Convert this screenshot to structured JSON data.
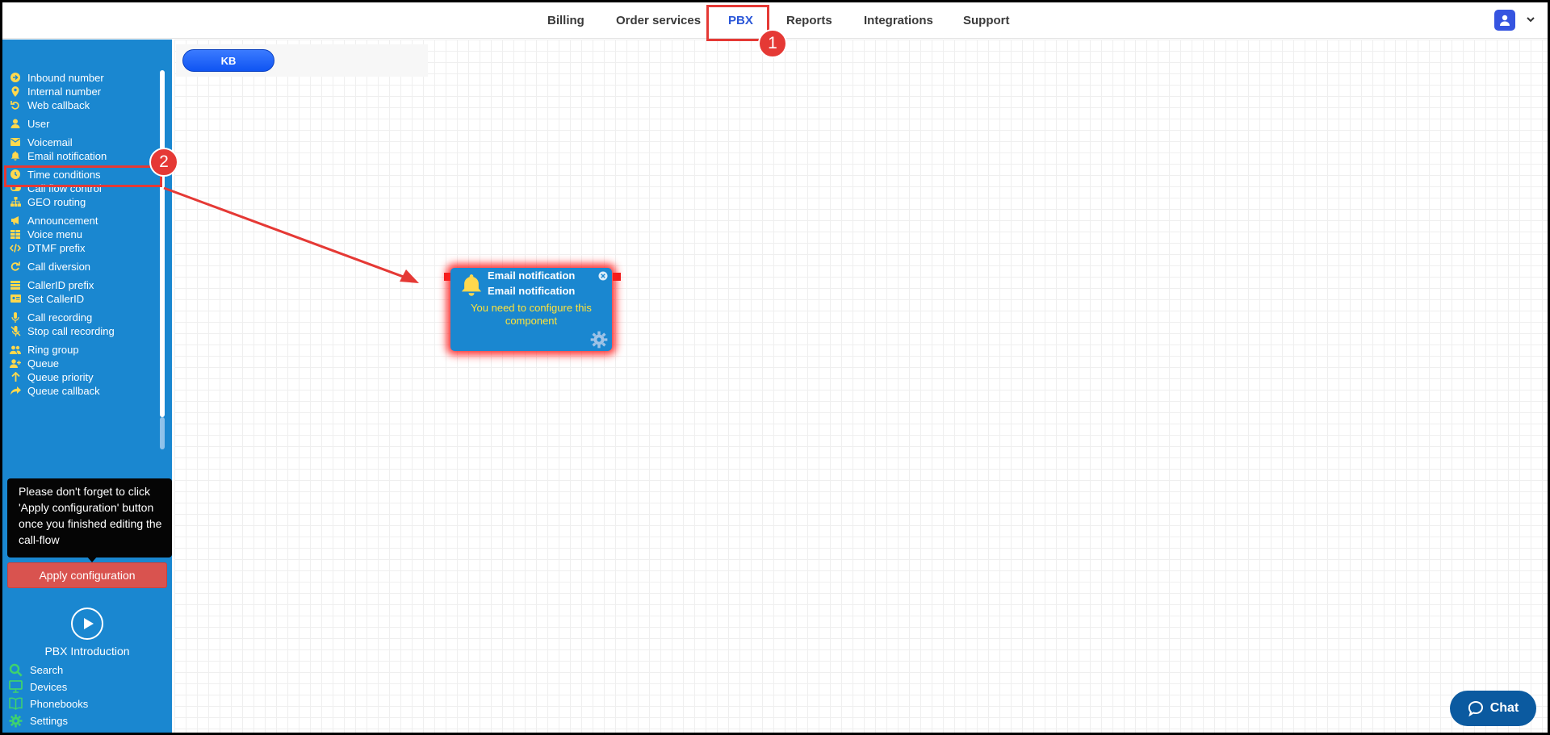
{
  "nav": {
    "items": [
      "Billing",
      "Order services",
      "PBX",
      "Reports",
      "Integrations",
      "Support"
    ],
    "active": "PBX"
  },
  "sidebar": {
    "items": [
      {
        "label": "Inbound number",
        "icon": "arrow-circle-right-icon"
      },
      {
        "label": "Internal number",
        "icon": "map-pin-icon"
      },
      {
        "label": "Web callback",
        "icon": "undo-icon"
      },
      {
        "label": "User",
        "icon": "user-icon"
      },
      {
        "label": "Voicemail",
        "icon": "envelope-icon"
      },
      {
        "label": "Email notification",
        "icon": "bell-icon"
      },
      {
        "label": "Time conditions",
        "icon": "clock-icon"
      },
      {
        "label": "Call flow control",
        "icon": "toggle-icon"
      },
      {
        "label": "GEO routing",
        "icon": "sitemap-icon"
      },
      {
        "label": "Announcement",
        "icon": "megaphone-icon"
      },
      {
        "label": "Voice menu",
        "icon": "grid-icon"
      },
      {
        "label": "DTMF prefix",
        "icon": "code-icon"
      },
      {
        "label": "Call diversion",
        "icon": "redo-icon"
      },
      {
        "label": "CallerID prefix",
        "icon": "list-icon"
      },
      {
        "label": "Set CallerID",
        "icon": "id-card-icon"
      },
      {
        "label": "Call recording",
        "icon": "microphone-icon"
      },
      {
        "label": "Stop call recording",
        "icon": "microphone-slash-icon"
      },
      {
        "label": "Ring group",
        "icon": "users-icon"
      },
      {
        "label": "Queue",
        "icon": "user-plus-icon"
      },
      {
        "label": "Queue priority",
        "icon": "arrow-up-icon"
      },
      {
        "label": "Queue callback",
        "icon": "share-icon"
      }
    ],
    "tooltip": "Please don't forget to click 'Apply configuration' button once you finished editing the call-flow",
    "apply_label": "Apply configuration",
    "intro_label": "PBX Introduction",
    "bottom_items": [
      {
        "label": "Search",
        "icon": "search-icon"
      },
      {
        "label": "Devices",
        "icon": "monitor-icon"
      },
      {
        "label": "Phonebooks",
        "icon": "book-icon"
      },
      {
        "label": "Settings",
        "icon": "gear-icon"
      }
    ]
  },
  "canvas": {
    "kb_label": "KB",
    "node": {
      "title": "Email notification",
      "subtitle": "Email notification",
      "warning": "You need to configure this component"
    }
  },
  "annotations": {
    "badge1": "1",
    "badge2": "2"
  },
  "chat": {
    "label": "Chat"
  },
  "colors": {
    "sidebar": "#1a87d0",
    "accent_icon": "#ffd84d",
    "apply_button": "#d9534f",
    "annotation": "#e53935",
    "nav_active": "#2b57d8"
  }
}
